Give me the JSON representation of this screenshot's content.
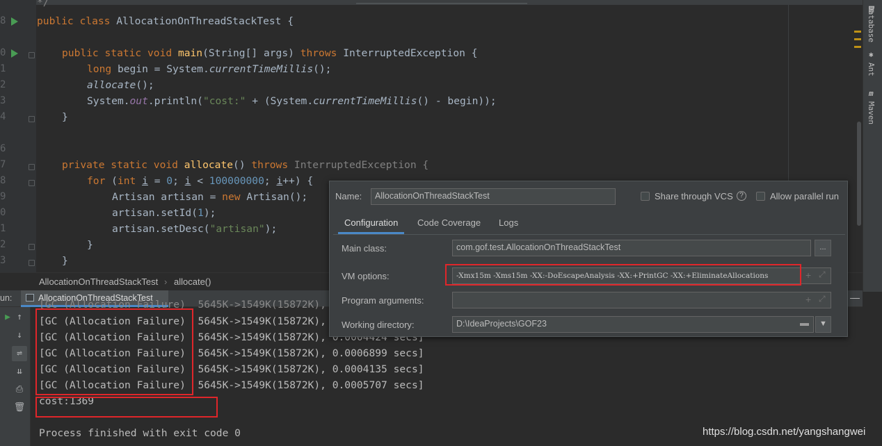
{
  "editor": {
    "line_numbers": [
      "8",
      "",
      "0",
      "1",
      "2",
      "3",
      "4",
      "",
      "6",
      "7",
      "8",
      "9",
      "0",
      "1",
      "2",
      "3"
    ],
    "code": {
      "class_line": {
        "kw": "public class ",
        "name": "AllocationOnThreadStackTest",
        "tail": " {"
      },
      "main_line": {
        "kw": "public static void ",
        "fn": "main",
        "args": "(String[] args) ",
        "throws": "throws ",
        "exc": "InterruptedException {"
      },
      "begin_line": {
        "kw": "long ",
        "a": "begin = System.",
        "m": "currentTimeMillis",
        "b": "();"
      },
      "alloc_call": {
        "m": "allocate",
        "b": "();"
      },
      "print_line": {
        "a": "System.",
        "f": "out",
        "b": ".println(",
        "s": "\"cost:\"",
        "c": " + (System.",
        "m": "currentTimeMillis",
        "d": "() - begin));"
      },
      "close_brace": "}",
      "alloc_decl": {
        "kw": "private static void ",
        "fn": "allocate",
        "a": "() ",
        "throws": "throws ",
        "exc": "InterruptedException {"
      },
      "for_line": {
        "kw": "for ",
        "a": "(",
        "kw2": "int ",
        "i1": "i",
        "b": " = ",
        "n0": "0",
        "c": "; ",
        "i2": "i",
        "d": " < ",
        "n1": "100000000",
        "e": "; ",
        "i3": "i",
        "f": "++) {"
      },
      "new_line": {
        "a": "Artisan artisan = ",
        "kw": "new ",
        "b": "Artisan();"
      },
      "setid_line": {
        "a": "artisan.setId(",
        "n": "1",
        "b": ");"
      },
      "setdesc_line": {
        "a": "artisan.setDesc(",
        "s": "\"artisan\"",
        "b": ");"
      },
      "inner_close": "}",
      "outer_close": "}",
      "top_comment": "*/"
    }
  },
  "right_strip": {
    "database": "Database",
    "ant": "Ant",
    "maven": "Maven",
    "maven_icon": "m"
  },
  "breadcrumb": {
    "class": "AllocationOnThreadStackTest",
    "sep": "›",
    "method": "allocate()"
  },
  "run_panel": {
    "label": "un:",
    "tab": "AllocationOnThreadStackTest",
    "minimize": "—",
    "console_lines": [
      "[GC (Allocation Failure)  5645K->1549K(15872K),",
      "[GC (Allocation Failure)  5645K->1549K(15872K), 0.0004424 secs]",
      "[GC (Allocation Failure)  5645K->1549K(15872K), 0.0006899 secs]",
      "[GC (Allocation Failure)  5645K->1549K(15872K), 0.0004135 secs]",
      "[GC (Allocation Failure)  5645K->1549K(15872K), 0.0005707 secs]"
    ],
    "first_line_partial": "[GC (Allocation Failure)  5645K->1549K(15872K),",
    "cost": "cost:1369",
    "finished": "Process finished with exit code 0",
    "watermark": "https://blog.csdn.net/yangshangwei"
  },
  "dialog": {
    "name_label": "Name:",
    "name_value": "AllocationOnThreadStackTest",
    "share_vcs": "Share through VCS",
    "help_icon": "?",
    "allow_parallel": "Allow parallel run",
    "tabs": [
      "Configuration",
      "Code Coverage",
      "Logs"
    ],
    "main_class_label": "Main class:",
    "main_class_value": "com.gof.test.AllocationOnThreadStackTest",
    "browse": "...",
    "vm_label": "VM options:",
    "vm_value": "-Xmx15m -Xms15m -XX:-DoEscapeAnalysis -XX:+PrintGC -XX:+EliminateAllocations",
    "program_args_label": "Program arguments:",
    "program_args_value": "",
    "workdir_label": "Working directory:",
    "workdir_value": "D:\\IdeaProjects\\GOF23"
  },
  "colors": {
    "highlight_box": "#e0262a",
    "accent": "#4a88c7",
    "keyword": "#cc7832",
    "method": "#ffc66d"
  }
}
